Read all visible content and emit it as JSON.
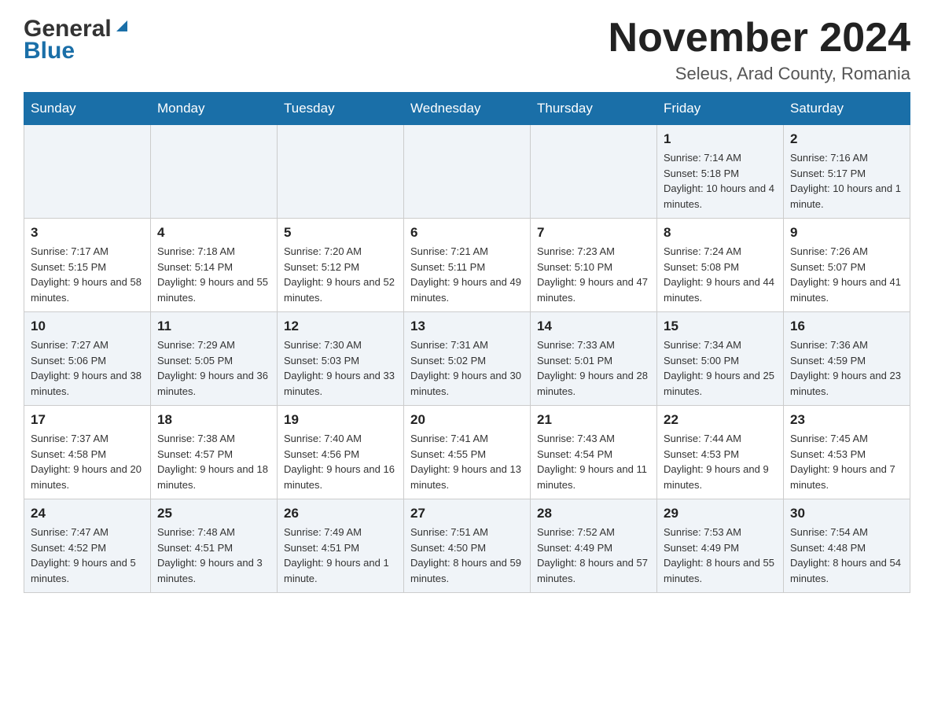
{
  "header": {
    "logo_general": "General",
    "logo_blue": "Blue",
    "month_title": "November 2024",
    "location": "Seleus, Arad County, Romania"
  },
  "days_of_week": [
    "Sunday",
    "Monday",
    "Tuesday",
    "Wednesday",
    "Thursday",
    "Friday",
    "Saturday"
  ],
  "weeks": [
    [
      {
        "day": "",
        "info": ""
      },
      {
        "day": "",
        "info": ""
      },
      {
        "day": "",
        "info": ""
      },
      {
        "day": "",
        "info": ""
      },
      {
        "day": "",
        "info": ""
      },
      {
        "day": "1",
        "info": "Sunrise: 7:14 AM\nSunset: 5:18 PM\nDaylight: 10 hours and 4 minutes."
      },
      {
        "day": "2",
        "info": "Sunrise: 7:16 AM\nSunset: 5:17 PM\nDaylight: 10 hours and 1 minute."
      }
    ],
    [
      {
        "day": "3",
        "info": "Sunrise: 7:17 AM\nSunset: 5:15 PM\nDaylight: 9 hours and 58 minutes."
      },
      {
        "day": "4",
        "info": "Sunrise: 7:18 AM\nSunset: 5:14 PM\nDaylight: 9 hours and 55 minutes."
      },
      {
        "day": "5",
        "info": "Sunrise: 7:20 AM\nSunset: 5:12 PM\nDaylight: 9 hours and 52 minutes."
      },
      {
        "day": "6",
        "info": "Sunrise: 7:21 AM\nSunset: 5:11 PM\nDaylight: 9 hours and 49 minutes."
      },
      {
        "day": "7",
        "info": "Sunrise: 7:23 AM\nSunset: 5:10 PM\nDaylight: 9 hours and 47 minutes."
      },
      {
        "day": "8",
        "info": "Sunrise: 7:24 AM\nSunset: 5:08 PM\nDaylight: 9 hours and 44 minutes."
      },
      {
        "day": "9",
        "info": "Sunrise: 7:26 AM\nSunset: 5:07 PM\nDaylight: 9 hours and 41 minutes."
      }
    ],
    [
      {
        "day": "10",
        "info": "Sunrise: 7:27 AM\nSunset: 5:06 PM\nDaylight: 9 hours and 38 minutes."
      },
      {
        "day": "11",
        "info": "Sunrise: 7:29 AM\nSunset: 5:05 PM\nDaylight: 9 hours and 36 minutes."
      },
      {
        "day": "12",
        "info": "Sunrise: 7:30 AM\nSunset: 5:03 PM\nDaylight: 9 hours and 33 minutes."
      },
      {
        "day": "13",
        "info": "Sunrise: 7:31 AM\nSunset: 5:02 PM\nDaylight: 9 hours and 30 minutes."
      },
      {
        "day": "14",
        "info": "Sunrise: 7:33 AM\nSunset: 5:01 PM\nDaylight: 9 hours and 28 minutes."
      },
      {
        "day": "15",
        "info": "Sunrise: 7:34 AM\nSunset: 5:00 PM\nDaylight: 9 hours and 25 minutes."
      },
      {
        "day": "16",
        "info": "Sunrise: 7:36 AM\nSunset: 4:59 PM\nDaylight: 9 hours and 23 minutes."
      }
    ],
    [
      {
        "day": "17",
        "info": "Sunrise: 7:37 AM\nSunset: 4:58 PM\nDaylight: 9 hours and 20 minutes."
      },
      {
        "day": "18",
        "info": "Sunrise: 7:38 AM\nSunset: 4:57 PM\nDaylight: 9 hours and 18 minutes."
      },
      {
        "day": "19",
        "info": "Sunrise: 7:40 AM\nSunset: 4:56 PM\nDaylight: 9 hours and 16 minutes."
      },
      {
        "day": "20",
        "info": "Sunrise: 7:41 AM\nSunset: 4:55 PM\nDaylight: 9 hours and 13 minutes."
      },
      {
        "day": "21",
        "info": "Sunrise: 7:43 AM\nSunset: 4:54 PM\nDaylight: 9 hours and 11 minutes."
      },
      {
        "day": "22",
        "info": "Sunrise: 7:44 AM\nSunset: 4:53 PM\nDaylight: 9 hours and 9 minutes."
      },
      {
        "day": "23",
        "info": "Sunrise: 7:45 AM\nSunset: 4:53 PM\nDaylight: 9 hours and 7 minutes."
      }
    ],
    [
      {
        "day": "24",
        "info": "Sunrise: 7:47 AM\nSunset: 4:52 PM\nDaylight: 9 hours and 5 minutes."
      },
      {
        "day": "25",
        "info": "Sunrise: 7:48 AM\nSunset: 4:51 PM\nDaylight: 9 hours and 3 minutes."
      },
      {
        "day": "26",
        "info": "Sunrise: 7:49 AM\nSunset: 4:51 PM\nDaylight: 9 hours and 1 minute."
      },
      {
        "day": "27",
        "info": "Sunrise: 7:51 AM\nSunset: 4:50 PM\nDaylight: 8 hours and 59 minutes."
      },
      {
        "day": "28",
        "info": "Sunrise: 7:52 AM\nSunset: 4:49 PM\nDaylight: 8 hours and 57 minutes."
      },
      {
        "day": "29",
        "info": "Sunrise: 7:53 AM\nSunset: 4:49 PM\nDaylight: 8 hours and 55 minutes."
      },
      {
        "day": "30",
        "info": "Sunrise: 7:54 AM\nSunset: 4:48 PM\nDaylight: 8 hours and 54 minutes."
      }
    ]
  ]
}
